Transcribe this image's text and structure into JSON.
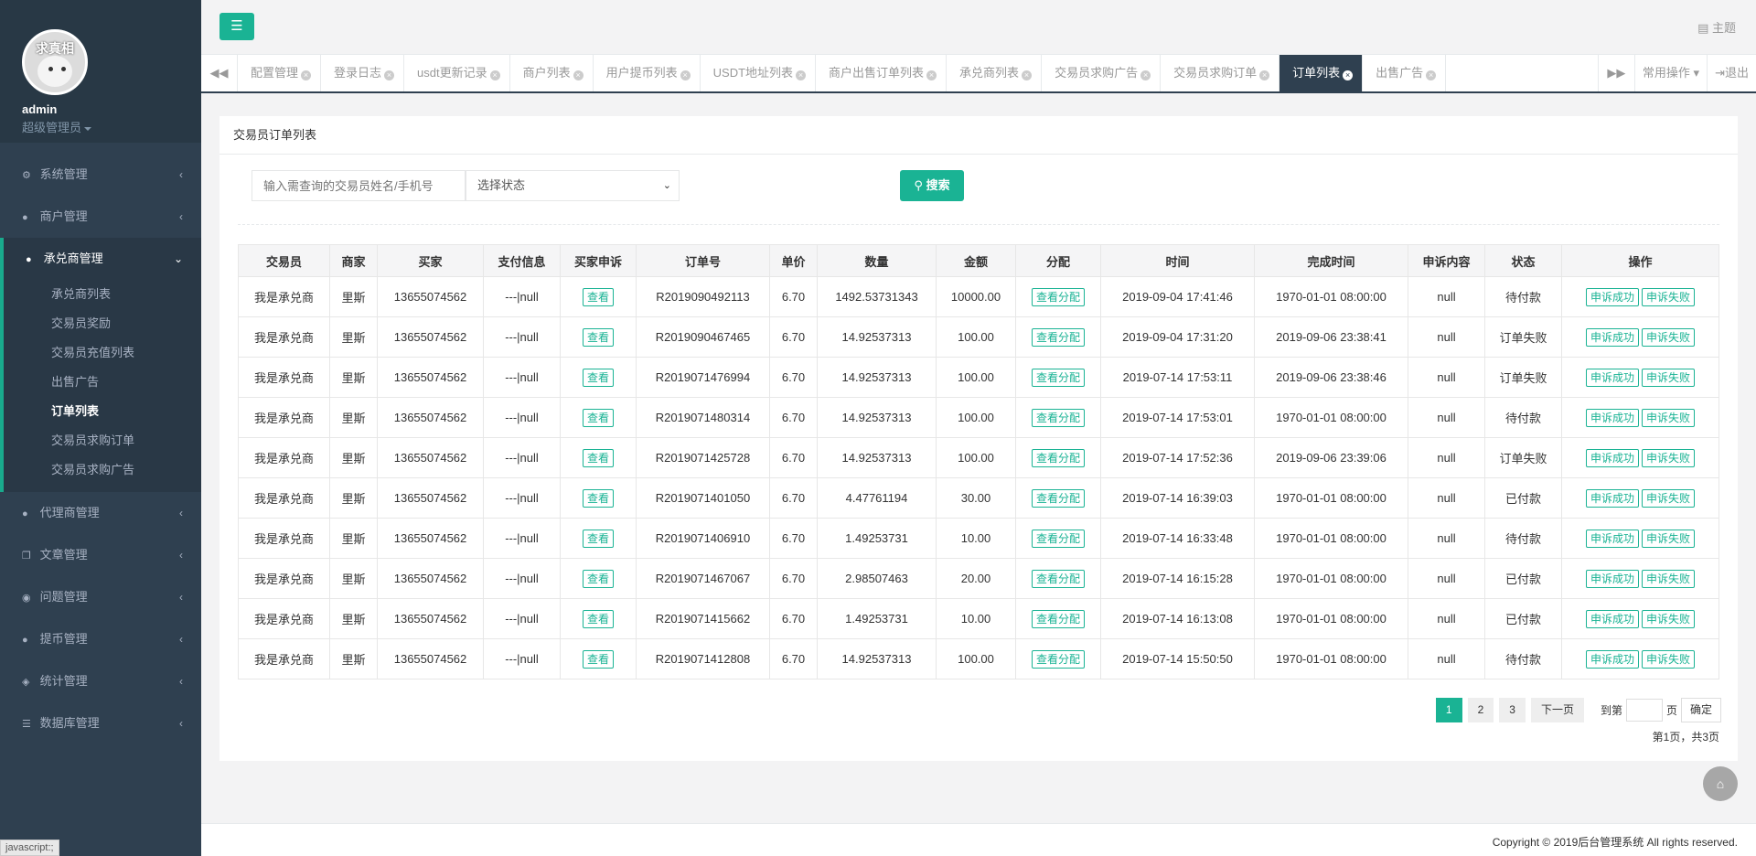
{
  "sidebar": {
    "avatar_text": "求真相",
    "admin_name": "admin",
    "admin_role": "超级管理员",
    "menu_top": [
      {
        "label": "系统管理",
        "icon": "gear-icon"
      },
      {
        "label": "商户管理",
        "icon": "user-icon"
      }
    ],
    "active_menu": {
      "label": "承兑商管理",
      "icon": "user-icon"
    },
    "submenu": [
      "承兑商列表",
      "交易员奖励",
      "交易员充值列表",
      "出售广告",
      "订单列表",
      "交易员求购订单",
      "交易员求购广告"
    ],
    "submenu_current": "订单列表",
    "menu_bottom": [
      {
        "label": "代理商管理",
        "icon": "user-icon"
      },
      {
        "label": "文章管理",
        "icon": "copy-icon"
      },
      {
        "label": "问题管理",
        "icon": "comment-icon"
      },
      {
        "label": "提币管理",
        "icon": "user-icon"
      },
      {
        "label": "统计管理",
        "icon": "cube-icon"
      },
      {
        "label": "数据库管理",
        "icon": "database-icon"
      }
    ]
  },
  "topbar": {
    "menu_icon": "bars-icon",
    "theme_label": "主题"
  },
  "tabs": {
    "items": [
      "配置管理",
      "登录日志",
      "usdt更新记录",
      "商户列表",
      "用户提币列表",
      "USDT地址列表",
      "商户出售订单列表",
      "承兑商列表",
      "交易员求购广告",
      "交易员求购订单",
      "订单列表",
      "出售广告"
    ],
    "active": "订单列表",
    "common_ops": "常用操作",
    "logout": "退出"
  },
  "panel": {
    "title": "交易员订单列表",
    "search_placeholder": "输入需查询的交易员姓名/手机号",
    "status_select": "选择状态",
    "search_button": "搜索"
  },
  "table": {
    "headers": [
      "交易员",
      "商家",
      "买家",
      "支付信息",
      "买家申诉",
      "订单号",
      "单价",
      "数量",
      "金额",
      "分配",
      "时间",
      "完成时间",
      "申诉内容",
      "状态",
      "操作"
    ],
    "view_label": "查看",
    "assign_label": "查看分配",
    "success_label": "申诉成功",
    "fail_label": "申诉失败",
    "rows": [
      [
        "我是承兑商",
        "里斯",
        "13655074562",
        "---|null",
        "R2019090492113",
        "6.70",
        "1492.53731343",
        "10000.00",
        "2019-09-04 17:41:46",
        "1970-01-01 08:00:00",
        "null",
        "待付款"
      ],
      [
        "我是承兑商",
        "里斯",
        "13655074562",
        "---|null",
        "R2019090467465",
        "6.70",
        "14.92537313",
        "100.00",
        "2019-09-04 17:31:20",
        "2019-09-06 23:38:41",
        "null",
        "订单失败"
      ],
      [
        "我是承兑商",
        "里斯",
        "13655074562",
        "---|null",
        "R2019071476994",
        "6.70",
        "14.92537313",
        "100.00",
        "2019-07-14 17:53:11",
        "2019-09-06 23:38:46",
        "null",
        "订单失败"
      ],
      [
        "我是承兑商",
        "里斯",
        "13655074562",
        "---|null",
        "R2019071480314",
        "6.70",
        "14.92537313",
        "100.00",
        "2019-07-14 17:53:01",
        "1970-01-01 08:00:00",
        "null",
        "待付款"
      ],
      [
        "我是承兑商",
        "里斯",
        "13655074562",
        "---|null",
        "R2019071425728",
        "6.70",
        "14.92537313",
        "100.00",
        "2019-07-14 17:52:36",
        "2019-09-06 23:39:06",
        "null",
        "订单失败"
      ],
      [
        "我是承兑商",
        "里斯",
        "13655074562",
        "---|null",
        "R2019071401050",
        "6.70",
        "4.47761194",
        "30.00",
        "2019-07-14 16:39:03",
        "1970-01-01 08:00:00",
        "null",
        "已付款"
      ],
      [
        "我是承兑商",
        "里斯",
        "13655074562",
        "---|null",
        "R2019071406910",
        "6.70",
        "1.49253731",
        "10.00",
        "2019-07-14 16:33:48",
        "1970-01-01 08:00:00",
        "null",
        "待付款"
      ],
      [
        "我是承兑商",
        "里斯",
        "13655074562",
        "---|null",
        "R2019071467067",
        "6.70",
        "2.98507463",
        "20.00",
        "2019-07-14 16:15:28",
        "1970-01-01 08:00:00",
        "null",
        "已付款"
      ],
      [
        "我是承兑商",
        "里斯",
        "13655074562",
        "---|null",
        "R2019071415662",
        "6.70",
        "1.49253731",
        "10.00",
        "2019-07-14 16:13:08",
        "1970-01-01 08:00:00",
        "null",
        "已付款"
      ],
      [
        "我是承兑商",
        "里斯",
        "13655074562",
        "---|null",
        "R2019071412808",
        "6.70",
        "14.92537313",
        "100.00",
        "2019-07-14 15:50:50",
        "1970-01-01 08:00:00",
        "null",
        "待付款"
      ]
    ]
  },
  "pagination": {
    "pages": [
      "1",
      "2",
      "3"
    ],
    "current": "1",
    "next": "下一页",
    "goto_label": "到第",
    "page_unit": "页",
    "confirm": "确定",
    "summary": "第1页，共3页"
  },
  "footer": {
    "copyright": "Copyright © 2019后台管理系统 All rights reserved."
  },
  "status_bar_text": "javascript:;",
  "colors": {
    "accent": "#1ab394",
    "sidebar_bg": "#2f4050",
    "active_tab_bg": "#2f4050"
  }
}
